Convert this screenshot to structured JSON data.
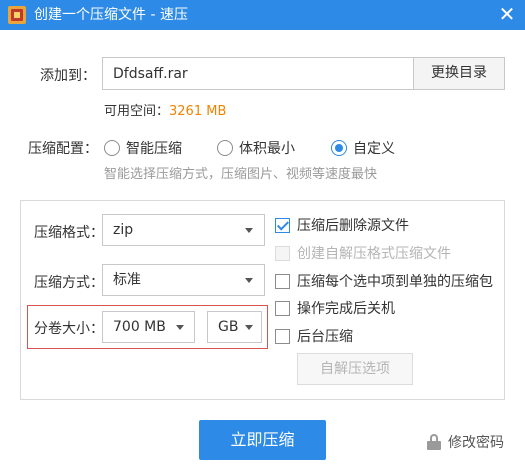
{
  "window": {
    "title": "创建一个压缩文件 - 速压",
    "close_glyph": "✕"
  },
  "target": {
    "label": "添加到：",
    "value": "Dfdsaff.rar",
    "change_dir_button": "更换目录",
    "free_space_label": "可用空间：",
    "free_space_value": "3261 MB",
    "free_space_color": "#f08300"
  },
  "config": {
    "label": "压缩配置：",
    "options": [
      {
        "label": "智能压缩",
        "selected": false
      },
      {
        "label": "体积最小",
        "selected": false
      },
      {
        "label": "自定义",
        "selected": true
      }
    ],
    "hint": "智能选择压缩方式，压缩图片、视频等速度最快"
  },
  "format": {
    "label": "压缩格式：",
    "value": "zip"
  },
  "method": {
    "label": "压缩方式：",
    "value": "标准"
  },
  "split": {
    "label": "分卷大小：",
    "size_value": "700 MB",
    "unit_value": "GB"
  },
  "options": {
    "delete_source": {
      "label": "压缩后删除源文件",
      "checked": true,
      "enabled": true
    },
    "self_extract": {
      "label": "创建自解压格式压缩文件",
      "checked": false,
      "enabled": false
    },
    "separate_archives": {
      "label": "压缩每个选中项到单独的压缩包",
      "checked": false,
      "enabled": true
    },
    "shutdown": {
      "label": "操作完成后关机",
      "checked": false,
      "enabled": true
    },
    "background": {
      "label": "后台压缩",
      "checked": false,
      "enabled": true
    },
    "sfx_options_button": "自解压选项"
  },
  "footer": {
    "compress_button": "立即压缩",
    "password_link": "修改密码"
  },
  "colors": {
    "accent": "#2d8ae6",
    "highlight_border": "#d9534f"
  }
}
